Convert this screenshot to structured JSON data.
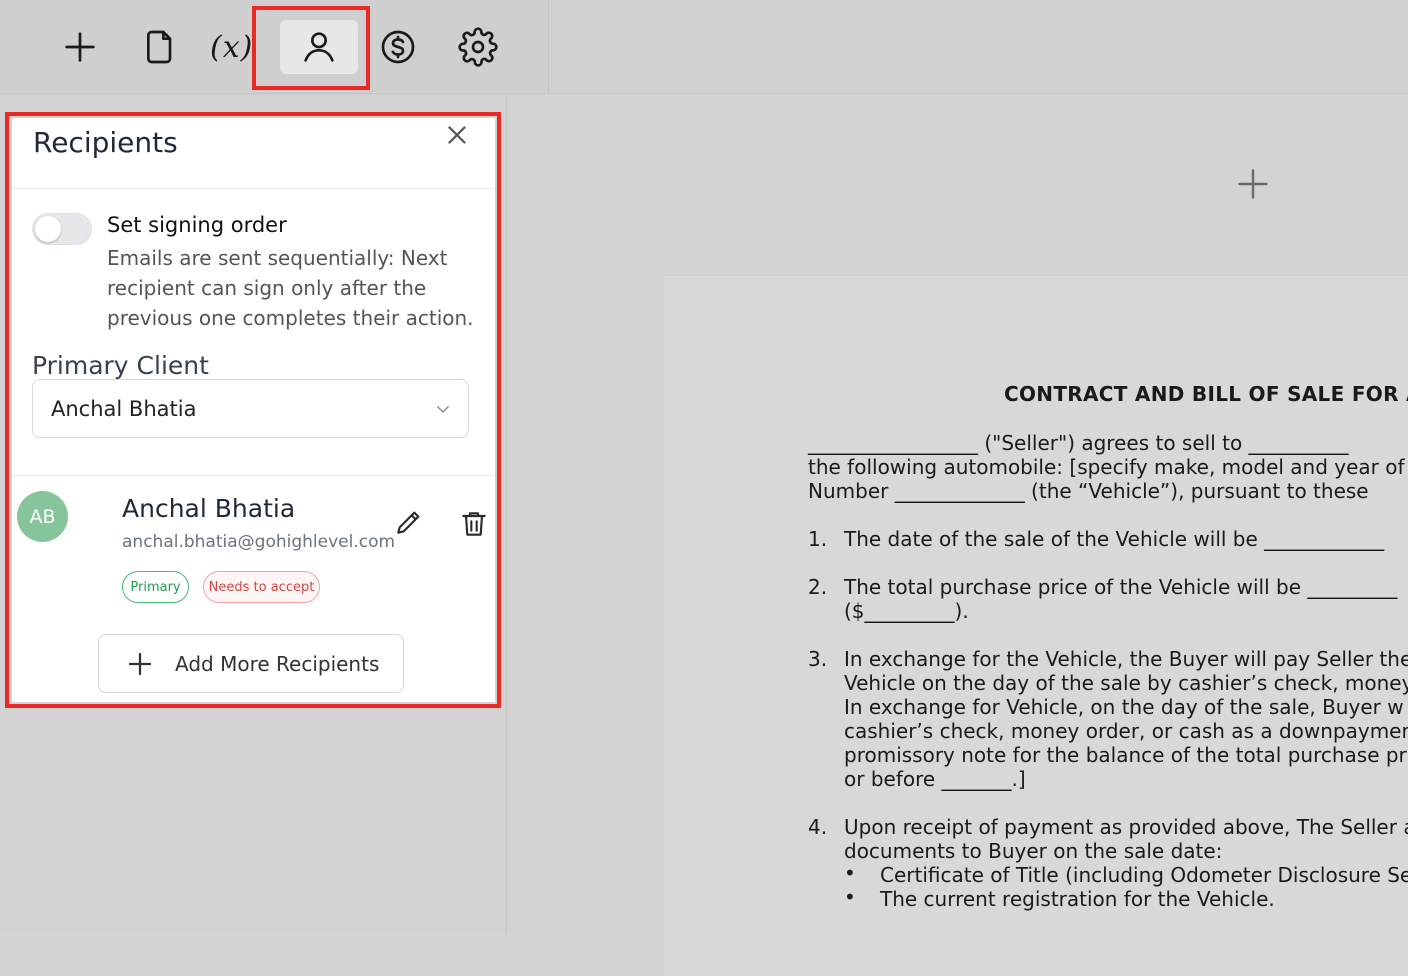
{
  "toolbar": {
    "var_label": "(x)",
    "items": [
      "add-icon",
      "document-icon",
      "variable-icon",
      "user-icon",
      "dollar-icon",
      "settings-icon"
    ],
    "highlight_color": "#ea2a22"
  },
  "recipients_panel": {
    "title": "Recipients",
    "signing_order": {
      "enabled": false,
      "title": "Set signing order",
      "description": "Emails are sent sequentially: Next recipient can sign only after the previous one completes their action."
    },
    "primary_client": {
      "label": "Primary Client",
      "selected": "Anchal Bhatia"
    },
    "recipients": [
      {
        "initials": "AB",
        "name": "Anchal Bhatia",
        "email": "anchal.bhatia@gohighlevel.com",
        "badges": [
          "Primary",
          "Needs to accept"
        ],
        "avatar_color": "#86c49c"
      }
    ],
    "add_button_label": "Add More Recipients"
  },
  "document": {
    "heading": "CONTRACT AND BILL OF SALE FOR A",
    "lines": [
      "_________________ (\"Seller\") agrees to sell to __________",
      "the following automobile: [specify make, model and year of",
      "Number _____________ (the “Vehicle”), pursuant to these"
    ],
    "items": [
      {
        "num": "1.",
        "lines": [
          "The date of the sale of the Vehicle will be ____________"
        ]
      },
      {
        "num": "2.",
        "lines": [
          "The total purchase price of the Vehicle will be _________",
          "($_________)."
        ]
      },
      {
        "num": "3.",
        "lines": [
          "In exchange for the Vehicle, the Buyer will pay Seller the",
          "Vehicle on the day of the sale by cashier’s check, money",
          "In exchange for Vehicle, on the day of the sale, Buyer w",
          "cashier’s check, money order, or cash as a downpaymen",
          "promissory note for the balance of the total purchase pr",
          "or before _______.]"
        ]
      },
      {
        "num": "4.",
        "lines": [
          "Upon receipt of payment as provided above, The Seller a",
          "documents to Buyer on the sale date:"
        ]
      }
    ],
    "bullets": [
      "Certificate of Title (including Odometer Disclosure Se",
      "The current registration for the Vehicle."
    ],
    "bullet_char": "•"
  }
}
